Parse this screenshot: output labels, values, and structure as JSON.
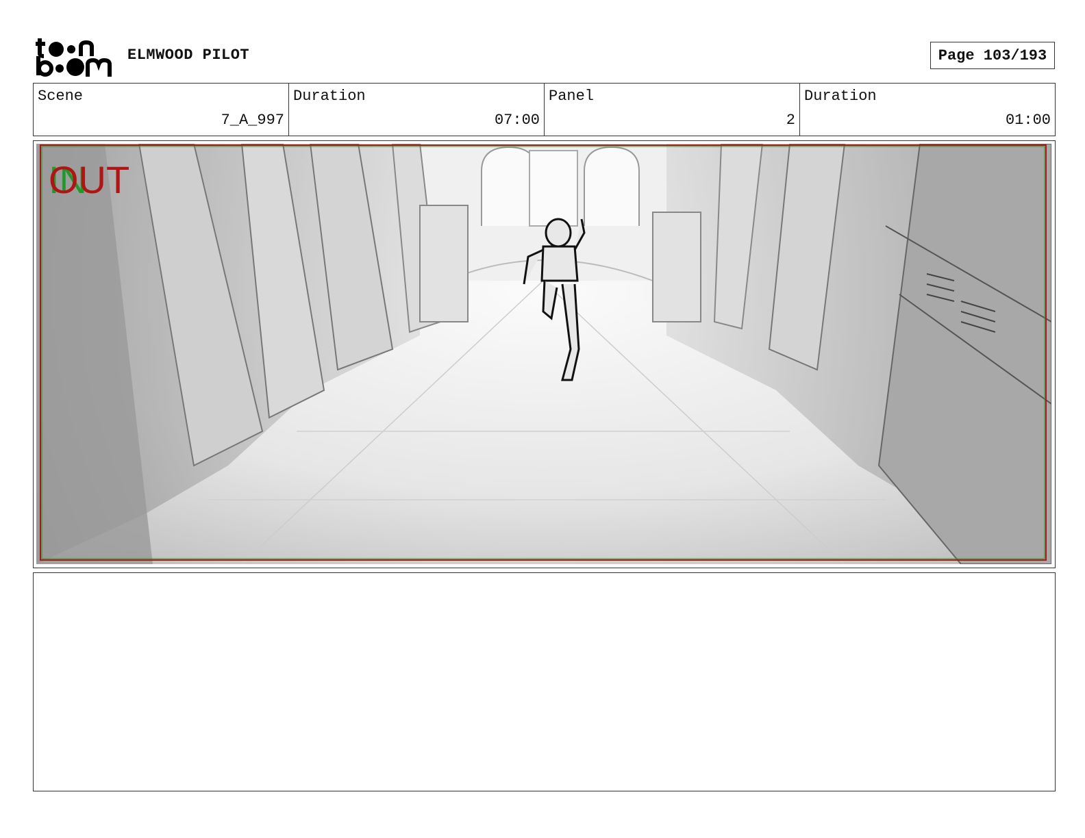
{
  "header": {
    "logo_text": "toon boom",
    "project_title": "ELMWOOD PILOT",
    "page_label": "Page 103/193"
  },
  "info": {
    "scene_label": "Scene",
    "scene_value": "7_A_997",
    "scene_duration_label": "Duration",
    "scene_duration_value": "07:00",
    "panel_label": "Panel",
    "panel_value": "2",
    "panel_duration_label": "Duration",
    "panel_duration_value": "01:00"
  },
  "panel": {
    "in_marker": "IN",
    "out_marker": "OUT",
    "in_color": "#1f9a2a",
    "out_color": "#b01515"
  },
  "notes": {
    "text": ""
  }
}
